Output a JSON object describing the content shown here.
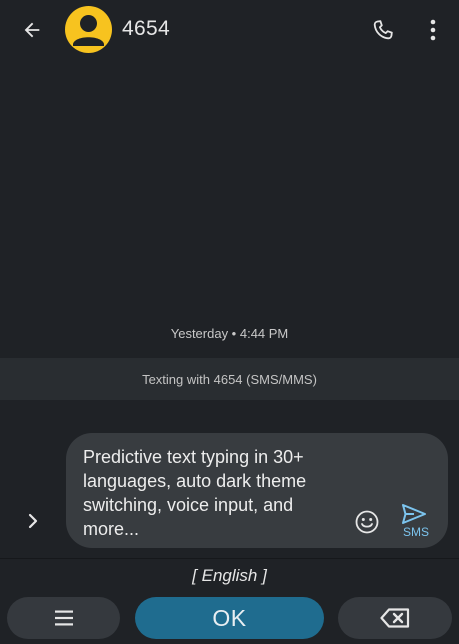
{
  "header": {
    "contact_name": "4654",
    "back_icon": "arrow-back-icon",
    "avatar_icon": "person-icon",
    "avatar_color": "#f7c31f",
    "call_icon": "phone-icon",
    "more_icon": "more-vert-icon"
  },
  "conversation": {
    "timestamp": "Yesterday • 4:44 PM",
    "banner": "Texting with 4654 (SMS/MMS)"
  },
  "compose": {
    "expand_icon": "chevron-right-icon",
    "text": "Predictive text typing in 30+ languages, auto dark theme switching, voice input, and more...",
    "emoji_icon": "emoji-icon",
    "send_icon": "send-icon",
    "send_label": "SMS",
    "accent_color": "#7cc4ee"
  },
  "keyboard": {
    "language": "[ English ]",
    "menu_icon": "menu-icon",
    "ok_label": "OK",
    "ok_color": "#1f6c8f",
    "backspace_icon": "backspace-icon"
  }
}
